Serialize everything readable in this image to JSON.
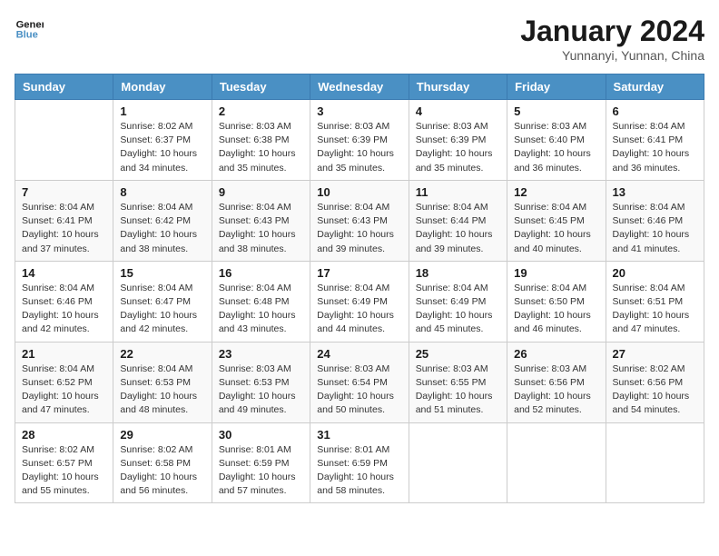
{
  "logo": {
    "line1": "General",
    "line2": "Blue"
  },
  "title": "January 2024",
  "subtitle": "Yunnanyi, Yunnan, China",
  "weekdays": [
    "Sunday",
    "Monday",
    "Tuesday",
    "Wednesday",
    "Thursday",
    "Friday",
    "Saturday"
  ],
  "weeks": [
    [
      {
        "day": "",
        "info": ""
      },
      {
        "day": "1",
        "info": "Sunrise: 8:02 AM\nSunset: 6:37 PM\nDaylight: 10 hours\nand 34 minutes."
      },
      {
        "day": "2",
        "info": "Sunrise: 8:03 AM\nSunset: 6:38 PM\nDaylight: 10 hours\nand 35 minutes."
      },
      {
        "day": "3",
        "info": "Sunrise: 8:03 AM\nSunset: 6:39 PM\nDaylight: 10 hours\nand 35 minutes."
      },
      {
        "day": "4",
        "info": "Sunrise: 8:03 AM\nSunset: 6:39 PM\nDaylight: 10 hours\nand 35 minutes."
      },
      {
        "day": "5",
        "info": "Sunrise: 8:03 AM\nSunset: 6:40 PM\nDaylight: 10 hours\nand 36 minutes."
      },
      {
        "day": "6",
        "info": "Sunrise: 8:04 AM\nSunset: 6:41 PM\nDaylight: 10 hours\nand 36 minutes."
      }
    ],
    [
      {
        "day": "7",
        "info": "Sunrise: 8:04 AM\nSunset: 6:41 PM\nDaylight: 10 hours\nand 37 minutes."
      },
      {
        "day": "8",
        "info": "Sunrise: 8:04 AM\nSunset: 6:42 PM\nDaylight: 10 hours\nand 38 minutes."
      },
      {
        "day": "9",
        "info": "Sunrise: 8:04 AM\nSunset: 6:43 PM\nDaylight: 10 hours\nand 38 minutes."
      },
      {
        "day": "10",
        "info": "Sunrise: 8:04 AM\nSunset: 6:43 PM\nDaylight: 10 hours\nand 39 minutes."
      },
      {
        "day": "11",
        "info": "Sunrise: 8:04 AM\nSunset: 6:44 PM\nDaylight: 10 hours\nand 39 minutes."
      },
      {
        "day": "12",
        "info": "Sunrise: 8:04 AM\nSunset: 6:45 PM\nDaylight: 10 hours\nand 40 minutes."
      },
      {
        "day": "13",
        "info": "Sunrise: 8:04 AM\nSunset: 6:46 PM\nDaylight: 10 hours\nand 41 minutes."
      }
    ],
    [
      {
        "day": "14",
        "info": "Sunrise: 8:04 AM\nSunset: 6:46 PM\nDaylight: 10 hours\nand 42 minutes."
      },
      {
        "day": "15",
        "info": "Sunrise: 8:04 AM\nSunset: 6:47 PM\nDaylight: 10 hours\nand 42 minutes."
      },
      {
        "day": "16",
        "info": "Sunrise: 8:04 AM\nSunset: 6:48 PM\nDaylight: 10 hours\nand 43 minutes."
      },
      {
        "day": "17",
        "info": "Sunrise: 8:04 AM\nSunset: 6:49 PM\nDaylight: 10 hours\nand 44 minutes."
      },
      {
        "day": "18",
        "info": "Sunrise: 8:04 AM\nSunset: 6:49 PM\nDaylight: 10 hours\nand 45 minutes."
      },
      {
        "day": "19",
        "info": "Sunrise: 8:04 AM\nSunset: 6:50 PM\nDaylight: 10 hours\nand 46 minutes."
      },
      {
        "day": "20",
        "info": "Sunrise: 8:04 AM\nSunset: 6:51 PM\nDaylight: 10 hours\nand 47 minutes."
      }
    ],
    [
      {
        "day": "21",
        "info": "Sunrise: 8:04 AM\nSunset: 6:52 PM\nDaylight: 10 hours\nand 47 minutes."
      },
      {
        "day": "22",
        "info": "Sunrise: 8:04 AM\nSunset: 6:53 PM\nDaylight: 10 hours\nand 48 minutes."
      },
      {
        "day": "23",
        "info": "Sunrise: 8:03 AM\nSunset: 6:53 PM\nDaylight: 10 hours\nand 49 minutes."
      },
      {
        "day": "24",
        "info": "Sunrise: 8:03 AM\nSunset: 6:54 PM\nDaylight: 10 hours\nand 50 minutes."
      },
      {
        "day": "25",
        "info": "Sunrise: 8:03 AM\nSunset: 6:55 PM\nDaylight: 10 hours\nand 51 minutes."
      },
      {
        "day": "26",
        "info": "Sunrise: 8:03 AM\nSunset: 6:56 PM\nDaylight: 10 hours\nand 52 minutes."
      },
      {
        "day": "27",
        "info": "Sunrise: 8:02 AM\nSunset: 6:56 PM\nDaylight: 10 hours\nand 54 minutes."
      }
    ],
    [
      {
        "day": "28",
        "info": "Sunrise: 8:02 AM\nSunset: 6:57 PM\nDaylight: 10 hours\nand 55 minutes."
      },
      {
        "day": "29",
        "info": "Sunrise: 8:02 AM\nSunset: 6:58 PM\nDaylight: 10 hours\nand 56 minutes."
      },
      {
        "day": "30",
        "info": "Sunrise: 8:01 AM\nSunset: 6:59 PM\nDaylight: 10 hours\nand 57 minutes."
      },
      {
        "day": "31",
        "info": "Sunrise: 8:01 AM\nSunset: 6:59 PM\nDaylight: 10 hours\nand 58 minutes."
      },
      {
        "day": "",
        "info": ""
      },
      {
        "day": "",
        "info": ""
      },
      {
        "day": "",
        "info": ""
      }
    ]
  ]
}
